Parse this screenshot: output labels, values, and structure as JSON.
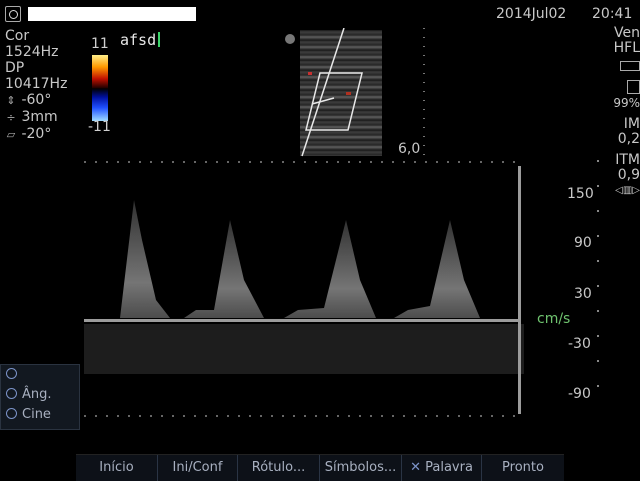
{
  "header": {
    "date": "2014Jul02",
    "time": "20:41"
  },
  "left_params": {
    "mode": "Cor",
    "freq": "1524Hz",
    "dp": "DP",
    "prf": "10417Hz",
    "angle": "-60°",
    "gate": "3mm",
    "steer": "-20°"
  },
  "color_scale": {
    "max": "11",
    "min": "-11"
  },
  "annotation": {
    "text": "afsd"
  },
  "bmode": {
    "depth": "6,0"
  },
  "right_panel": {
    "preset_1": "Ven",
    "preset_2": "HFL",
    "battery_pct": "99%",
    "im_label": "IM",
    "im_value": "0,2",
    "itm_label": "ITM",
    "itm_value": "0,9"
  },
  "velocity_scale": {
    "unit": "cm/s",
    "ticks": [
      "150",
      "90",
      "30",
      "-30",
      "-90"
    ]
  },
  "side_menu": {
    "items": [
      "",
      "Âng.",
      "Cine"
    ]
  },
  "bottom_bar": {
    "buttons": [
      "Início",
      "Ini/Conf",
      "Rótulo...",
      "Símbolos...",
      "Palavra",
      "Pronto"
    ]
  }
}
